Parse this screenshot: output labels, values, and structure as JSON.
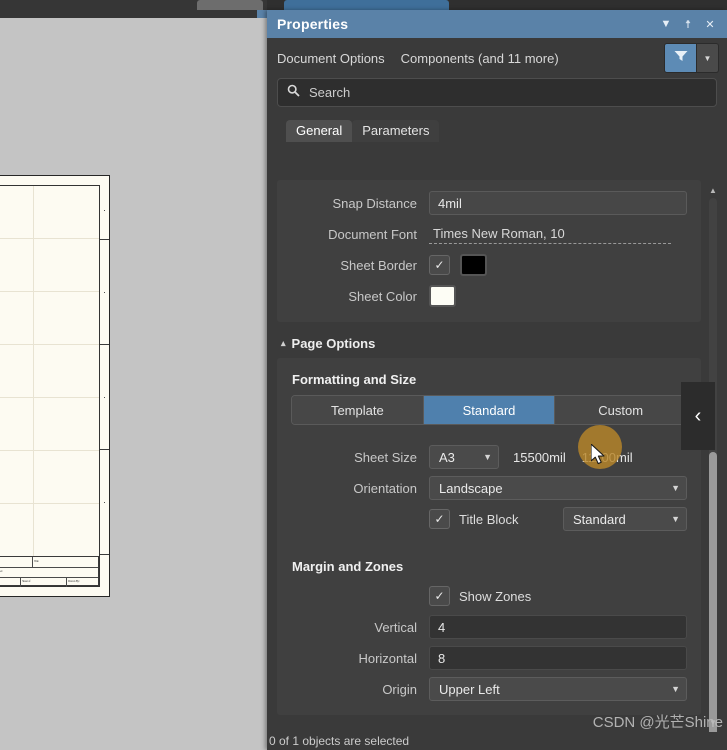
{
  "window": {
    "panel_title": "Properties",
    "title_icons": [
      {
        "name": "chevron-down-icon",
        "glyph": "▼"
      },
      {
        "name": "pin-icon",
        "glyph": "☨"
      },
      {
        "name": "close-icon",
        "glyph": "✕"
      }
    ]
  },
  "subbar": {
    "crumb_primary": "Document Options",
    "crumb_secondary": "Components (and 11 more)",
    "filter_icon": "filter-funnel-icon",
    "filter_dropdown_glyph": "▼"
  },
  "search": {
    "icon": "search-icon",
    "placeholder": "Search",
    "value": ""
  },
  "tabs": [
    {
      "label": "General",
      "active": true
    },
    {
      "label": "Parameters",
      "active": false
    }
  ],
  "general": {
    "snap_distance": {
      "label": "Snap Distance",
      "value": "4mil"
    },
    "document_font": {
      "label": "Document Font",
      "value": "Times New Roman, 10"
    },
    "sheet_border": {
      "label": "Sheet Border",
      "checked": true,
      "color": "#000000"
    },
    "sheet_color": {
      "label": "Sheet Color",
      "color": "#fdfdf5"
    }
  },
  "page_options": {
    "section_title": "Page Options",
    "caret": "▴",
    "formatting": {
      "title": "Formatting and Size",
      "modes": [
        {
          "label": "Template",
          "active": false
        },
        {
          "label": "Standard",
          "active": true
        },
        {
          "label": "Custom",
          "active": false
        }
      ],
      "sheet_size": {
        "label": "Sheet Size",
        "value": "A3",
        "width": "15500mil",
        "height": "11100mil"
      },
      "orientation": {
        "label": "Orientation",
        "value": "Landscape"
      },
      "title_block": {
        "label": "Title Block",
        "checked": true,
        "value": "Standard"
      }
    },
    "margin_zones": {
      "title": "Margin and Zones",
      "show_zones": {
        "label": "Show Zones",
        "checked": true
      },
      "vertical": {
        "label": "Vertical",
        "value": "4"
      },
      "horizontal": {
        "label": "Horizontal",
        "value": "8"
      },
      "origin": {
        "label": "Origin",
        "value": "Upper Left"
      }
    }
  },
  "statusbar": {
    "text": "0 of 1 objects are selected"
  },
  "watermark": {
    "text": "CSDN @光芒Shine"
  },
  "collapse": {
    "glyph": "‹",
    "name": "collapse-panel-arrow-icon"
  },
  "scrollbar": {
    "up_glyph": "▲",
    "down_glyph": "▼"
  },
  "canvas": {
    "title_block_rows": [
      "Title",
      "Size",
      "Number",
      "Rev",
      "Date",
      "Sheet of",
      "File",
      "Drawn By"
    ]
  },
  "colors": {
    "accent_blue": "#5a82a8",
    "seg_active": "#4f80ad",
    "panel_bg": "#3a3a3a",
    "group_bg": "#404040",
    "field_bg": "#333333",
    "canvas_bg": "#c4c4c4",
    "sheet_bg": "#fdfbf2",
    "click_halo": "#b8862a"
  }
}
